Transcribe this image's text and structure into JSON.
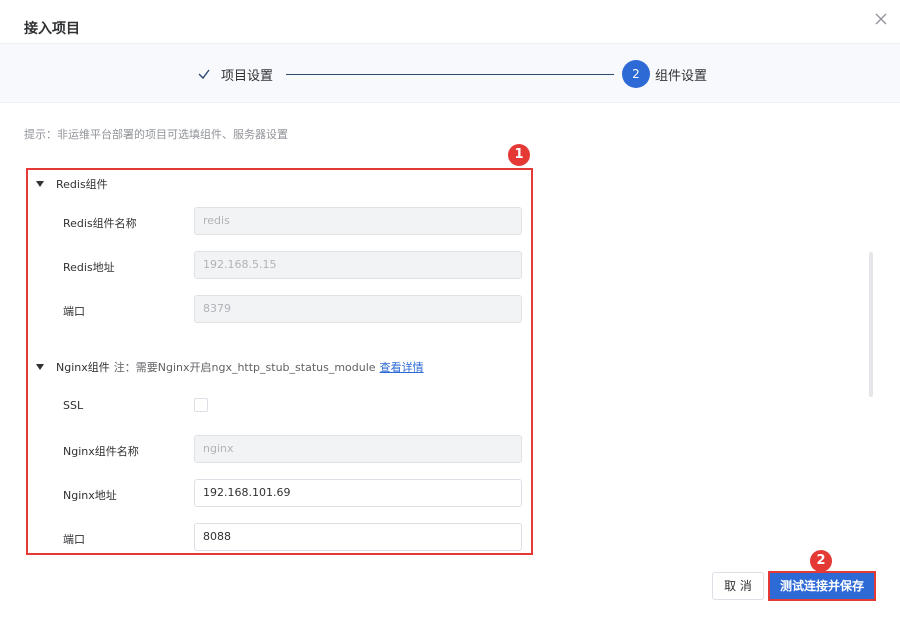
{
  "dialog": {
    "title": "接入项目",
    "close_icon": "close-icon"
  },
  "steps": [
    {
      "label": "项目设置",
      "status": "done",
      "icon": "check-icon"
    },
    {
      "number": "2",
      "label": "组件设置",
      "status": "active"
    }
  ],
  "tip": "提示：非运维平台部署的项目可选填组件、服务器设置",
  "markers": [
    "1",
    "2"
  ],
  "redis": {
    "section_title": "Redis组件",
    "name_label": "Redis组件名称",
    "name_placeholder": "redis",
    "address_label": "Redis地址",
    "address_value": "192.168.5.15",
    "port_label": "端口",
    "port_value": "8379"
  },
  "nginx": {
    "section_title": "Nginx组件",
    "note": "注：需要Nginx开启ngx_http_stub_status_module",
    "detail_link": "查看详情",
    "ssl_label": "SSL",
    "ssl_checked": false,
    "name_label": "Nginx组件名称",
    "name_placeholder": "nginx",
    "address_label": "Nginx地址",
    "address_value": "192.168.101.69",
    "port_label": "端口",
    "port_value": "8088"
  },
  "footer": {
    "cancel_label": "取 消",
    "save_label": "测试连接并保存"
  },
  "colors": {
    "primary": "#2d6ad6",
    "annotation_red": "#e53935",
    "step_line": "#2c4a6e"
  }
}
